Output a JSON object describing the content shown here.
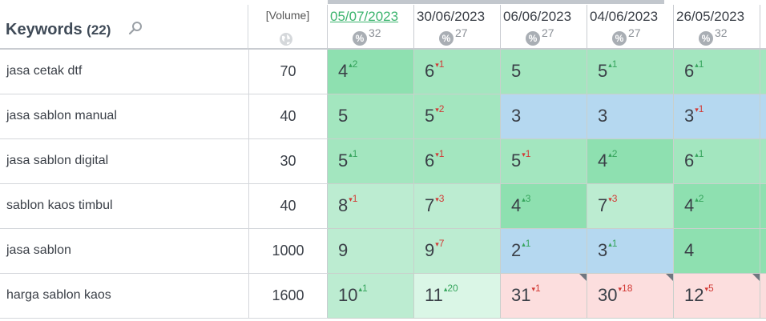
{
  "header": {
    "keywords_label": "Keywords",
    "keywords_count": "(22)",
    "volume_label": "[Volume]",
    "search_icon": "search-icon",
    "globe_icon": "globe-icon"
  },
  "dates": [
    {
      "label": "05/07/2023",
      "diff": "32",
      "active": true
    },
    {
      "label": "30/06/2023",
      "diff": "27",
      "active": false
    },
    {
      "label": "06/06/2023",
      "diff": "27",
      "active": false
    },
    {
      "label": "04/06/2023",
      "diff": "27",
      "active": false
    },
    {
      "label": "26/05/2023",
      "diff": "32",
      "active": false
    }
  ],
  "pct_symbol": "%",
  "rows": [
    {
      "keyword": "jasa cetak dtf",
      "volume": "70",
      "cells": [
        {
          "pos": "4",
          "chg": "2",
          "dir": "up",
          "color": "#8ee0b0",
          "flag": false
        },
        {
          "pos": "6",
          "chg": "1",
          "dir": "down",
          "color": "#a3e6bf",
          "flag": false
        },
        {
          "pos": "5",
          "chg": "",
          "dir": "",
          "color": "#a3e6bf",
          "flag": false
        },
        {
          "pos": "5",
          "chg": "1",
          "dir": "up",
          "color": "#a3e6bf",
          "flag": false
        },
        {
          "pos": "6",
          "chg": "1",
          "dir": "up",
          "color": "#a3e6bf",
          "flag": false
        }
      ]
    },
    {
      "keyword": "jasa sablon manual",
      "volume": "40",
      "cells": [
        {
          "pos": "5",
          "chg": "",
          "dir": "",
          "color": "#a3e6bf",
          "flag": false
        },
        {
          "pos": "5",
          "chg": "2",
          "dir": "down",
          "color": "#a3e6bf",
          "flag": false
        },
        {
          "pos": "3",
          "chg": "",
          "dir": "",
          "color": "#b5d8f0",
          "flag": false
        },
        {
          "pos": "3",
          "chg": "",
          "dir": "",
          "color": "#b5d8f0",
          "flag": false
        },
        {
          "pos": "3",
          "chg": "1",
          "dir": "down",
          "color": "#b5d8f0",
          "flag": false
        }
      ]
    },
    {
      "keyword": "jasa sablon digital",
      "volume": "30",
      "cells": [
        {
          "pos": "5",
          "chg": "1",
          "dir": "up",
          "color": "#a3e6bf",
          "flag": false
        },
        {
          "pos": "6",
          "chg": "1",
          "dir": "down",
          "color": "#a3e6bf",
          "flag": false
        },
        {
          "pos": "5",
          "chg": "1",
          "dir": "down",
          "color": "#a3e6bf",
          "flag": false
        },
        {
          "pos": "4",
          "chg": "2",
          "dir": "up",
          "color": "#8ee0b0",
          "flag": false
        },
        {
          "pos": "6",
          "chg": "1",
          "dir": "up",
          "color": "#a3e6bf",
          "flag": false
        }
      ]
    },
    {
      "keyword": "sablon kaos timbul",
      "volume": "40",
      "cells": [
        {
          "pos": "8",
          "chg": "1",
          "dir": "down",
          "color": "#bcecd1",
          "flag": false
        },
        {
          "pos": "7",
          "chg": "3",
          "dir": "down",
          "color": "#bcecd1",
          "flag": false
        },
        {
          "pos": "4",
          "chg": "3",
          "dir": "up",
          "color": "#8ee0b0",
          "flag": false
        },
        {
          "pos": "7",
          "chg": "3",
          "dir": "down",
          "color": "#bcecd1",
          "flag": false
        },
        {
          "pos": "4",
          "chg": "2",
          "dir": "up",
          "color": "#8ee0b0",
          "flag": false
        }
      ]
    },
    {
      "keyword": "jasa sablon",
      "volume": "1000",
      "cells": [
        {
          "pos": "9",
          "chg": "",
          "dir": "",
          "color": "#bcecd1",
          "flag": false
        },
        {
          "pos": "9",
          "chg": "7",
          "dir": "down",
          "color": "#bcecd1",
          "flag": false
        },
        {
          "pos": "2",
          "chg": "1",
          "dir": "up",
          "color": "#b5d8f0",
          "flag": false
        },
        {
          "pos": "3",
          "chg": "1",
          "dir": "up",
          "color": "#b5d8f0",
          "flag": false
        },
        {
          "pos": "4",
          "chg": "",
          "dir": "",
          "color": "#8ee0b0",
          "flag": false
        }
      ]
    },
    {
      "keyword": "harga sablon kaos",
      "volume": "1600",
      "cells": [
        {
          "pos": "10",
          "chg": "1",
          "dir": "up",
          "color": "#bcecd1",
          "flag": false
        },
        {
          "pos": "11",
          "chg": "20",
          "dir": "up",
          "color": "#daf6e6",
          "flag": false
        },
        {
          "pos": "31",
          "chg": "1",
          "dir": "down",
          "color": "#fcdede",
          "flag": true
        },
        {
          "pos": "30",
          "chg": "18",
          "dir": "down",
          "color": "#fcdede",
          "flag": true
        },
        {
          "pos": "12",
          "chg": "5",
          "dir": "down",
          "color": "#fcdede",
          "flag": true
        }
      ]
    }
  ]
}
